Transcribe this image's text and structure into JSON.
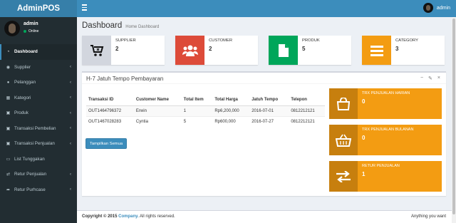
{
  "app": {
    "title": "AdminPOS"
  },
  "topbar": {
    "user": "admin"
  },
  "sidebar": {
    "user": {
      "name": "admin",
      "status": "Online"
    },
    "items": [
      {
        "label": "Dashboard",
        "icon": "dashboard-icon",
        "has_children": false
      },
      {
        "label": "Supplier",
        "icon": "users-icon",
        "has_children": true
      },
      {
        "label": "Pelanggan",
        "icon": "user-icon",
        "has_children": true
      },
      {
        "label": "Kategori",
        "icon": "table-icon",
        "has_children": true
      },
      {
        "label": "Produk",
        "icon": "cart-icon",
        "has_children": true
      },
      {
        "label": "Transaksi Pembelian",
        "icon": "cart-icon",
        "has_children": true
      },
      {
        "label": "Transaksi Penjualan",
        "icon": "cart-icon",
        "has_children": true
      },
      {
        "label": "List Tunggakan",
        "icon": "id-card-icon",
        "has_children": false
      },
      {
        "label": "Retur Penjualan",
        "icon": "shuffle-icon",
        "has_children": true
      },
      {
        "label": "Retur Purhcase",
        "icon": "share-icon",
        "has_children": true
      }
    ]
  },
  "content": {
    "title": "Dashboard",
    "breadcrumb": "Home Dashboard"
  },
  "info_boxes": [
    {
      "label": "SUPPLIER",
      "value": "2",
      "color": "#d2d6de",
      "icon": "cart-icon"
    },
    {
      "label": "CUSTOMER",
      "value": "2",
      "color": "#dd4b39",
      "icon": "users-icon"
    },
    {
      "label": "PRODUK",
      "value": "5",
      "color": "#00a65a",
      "icon": "file-icon"
    },
    {
      "label": "CATEGORY",
      "value": "3",
      "color": "#f39c12",
      "icon": "bars-icon"
    }
  ],
  "panel": {
    "title": "H-7 Jatuh Tempo Pembayaran",
    "columns": [
      "Transaksi ID",
      "Customer Name",
      "Total Item",
      "Total Harga",
      "Jatuh Tempo",
      "Telepon"
    ],
    "rows": [
      [
        "OUT1464796372",
        "Erwin",
        "1",
        "Rp6,200,000",
        "2016-07-01",
        "0812212121"
      ],
      [
        "OUT1467028283",
        "Cyntia",
        "5",
        "Rp600,000",
        "2016-07-27",
        "0812212121"
      ]
    ],
    "button": "Tampilkan Semua"
  },
  "side_boxes": [
    {
      "label": "TRX PENJUALAN HARIAN",
      "value": "0",
      "icon": "shopping-bag-icon"
    },
    {
      "label": "TRX PENJUALAN BULANAN",
      "value": "0",
      "icon": "basket-icon"
    },
    {
      "label": "RETUR PENJUALAN",
      "value": "1",
      "icon": "exchange-icon"
    }
  ],
  "footer": {
    "copyright": "Copyright © 2015",
    "company": "Company.",
    "rights": "All rights reserved.",
    "right_text": "Anything you want"
  }
}
